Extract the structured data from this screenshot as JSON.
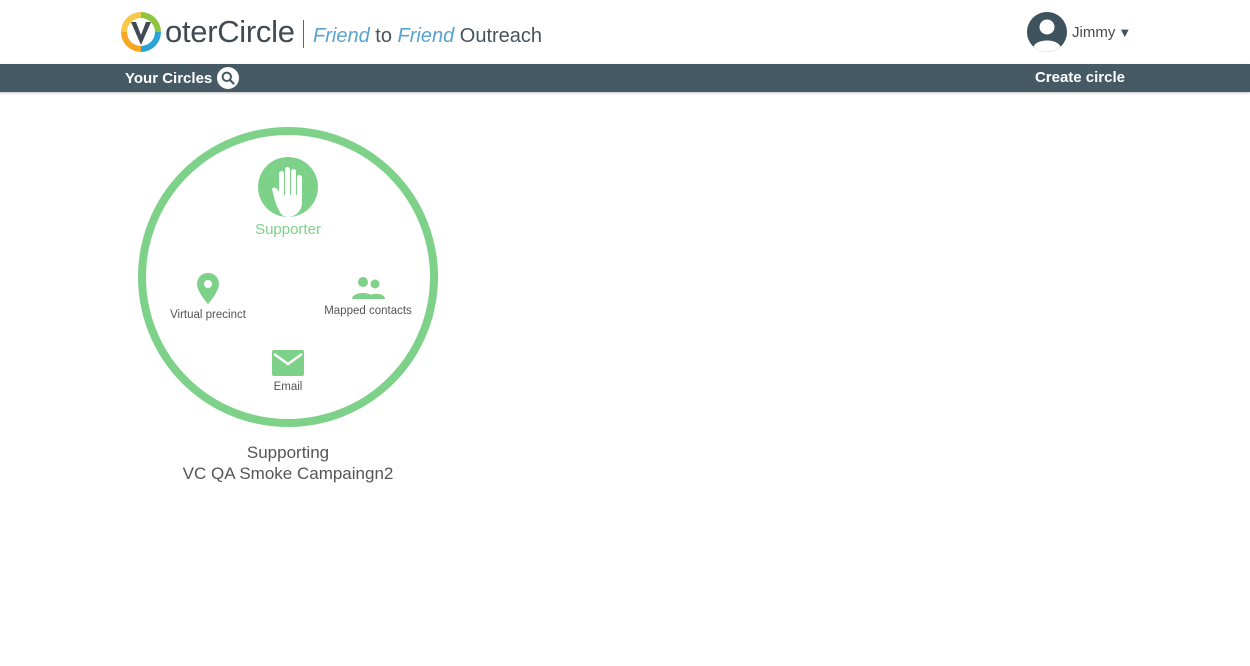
{
  "brand": {
    "logo_text": "oterCircle",
    "logo_mark": "V",
    "tagline": {
      "word1": "Friend",
      "word2": "to",
      "word3": "Friend",
      "word4": "Outreach"
    },
    "colors": {
      "ring_green": "#7ed189",
      "navbar": "#455a64",
      "accent_blue": "#5aa2cf"
    }
  },
  "user": {
    "name": "Jimmy",
    "avatar_icon": "user-avatar-icon",
    "menu_icon": "caret-down-icon"
  },
  "navbar": {
    "left_label": "Your Circles",
    "search_icon": "search-icon",
    "right_label": "Create circle"
  },
  "circles": [
    {
      "role": "Supporter",
      "role_icon": "raised-hand-icon",
      "features": [
        {
          "label": "Virtual precinct",
          "icon": "map-pin-icon"
        },
        {
          "label": "Mapped contacts",
          "icon": "people-icon"
        },
        {
          "label": "Email",
          "icon": "envelope-icon"
        }
      ],
      "caption_line1": "Supporting",
      "caption_line2": "VC QA Smoke Campaingn2"
    }
  ]
}
